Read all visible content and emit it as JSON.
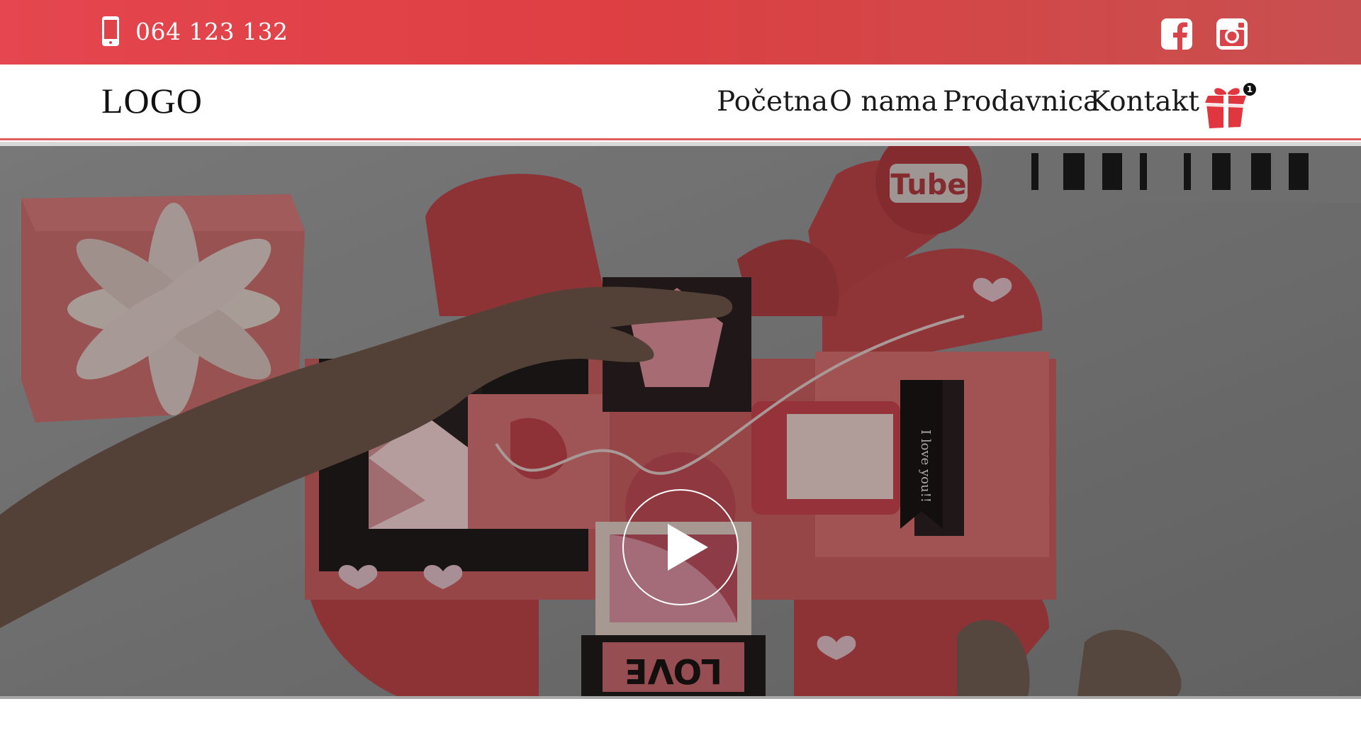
{
  "topbar": {
    "phone_icon": "mobile-phone-icon",
    "phone": "064 123 132",
    "social": [
      {
        "icon": "facebook-icon"
      },
      {
        "icon": "instagram-icon"
      }
    ],
    "colors": {
      "from": "#e5464f",
      "to": "#c84f50"
    }
  },
  "header": {
    "logo": "LOGO",
    "nav": [
      "Početna",
      "O nama",
      "Prodavnica",
      "Kontakt"
    ],
    "cart": {
      "icon": "gift-cart-icon",
      "count": "1"
    },
    "accent": "#e0363f"
  },
  "video": {
    "play_icon": "play-icon",
    "watermark": "You Tube",
    "caption_text": "I love you!!",
    "love_text": "LOVE"
  }
}
